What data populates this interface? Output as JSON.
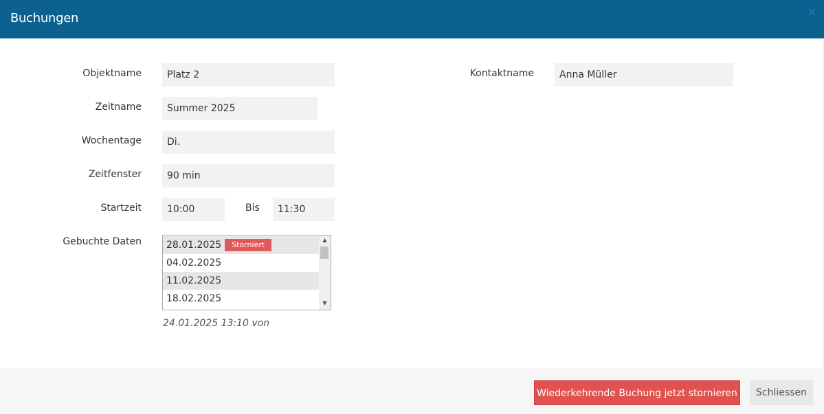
{
  "dialog": {
    "title": "Buchungen",
    "close_icon": "×"
  },
  "form": {
    "objektname": {
      "label": "Objektname",
      "value": "Platz 2"
    },
    "zeitname": {
      "label": "Zeitname",
      "value": "Summer 2025"
    },
    "wochentage": {
      "label": "Wochentage",
      "value": "Di."
    },
    "zeitfenster": {
      "label": "Zeitfenster",
      "value": "90 min"
    },
    "startzeit": {
      "label": "Startzeit",
      "value": "10:00"
    },
    "bis": {
      "label": "Bis",
      "value": "11:30"
    },
    "gebuchte_daten": {
      "label": "Gebuchte Daten",
      "items": [
        {
          "date": "28.01.2025",
          "badge": "Storniert"
        },
        {
          "date": "04.02.2025"
        },
        {
          "date": "11.02.2025"
        },
        {
          "date": "18.02.2025"
        }
      ]
    },
    "meta": "24.01.2025 13:10 von",
    "kontaktname": {
      "label": "Kontaktname",
      "value": "Anna Müller"
    }
  },
  "footer": {
    "cancel_series_label": "Wiederkehrende Buchung jetzt stornieren",
    "close_label": "Schliessen"
  },
  "colors": {
    "header": "#0d6190",
    "danger": "#e0524f",
    "badge": "#e05a5a",
    "field_bg": "#f2f2f2"
  }
}
